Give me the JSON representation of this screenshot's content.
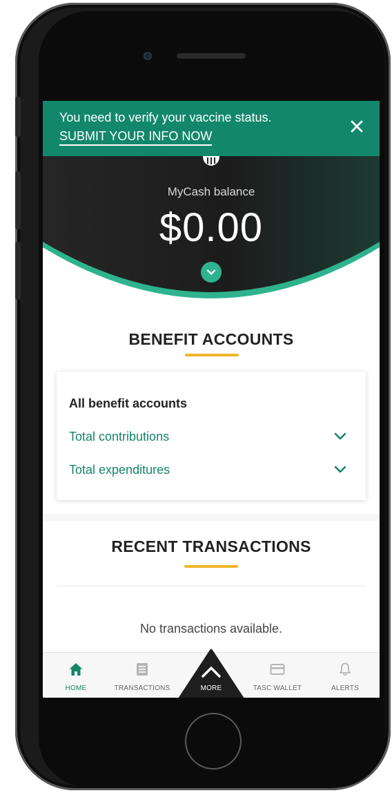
{
  "banner": {
    "message": "You need to verify your vaccine status.",
    "link_label": "SUBMIT YOUR INFO NOW"
  },
  "balance": {
    "label": "MyCash balance",
    "amount": "$0.00"
  },
  "benefit_accounts": {
    "title": "BENEFIT ACCOUNTS",
    "card_heading": "All benefit accounts",
    "rows": [
      {
        "label": "Total contributions"
      },
      {
        "label": "Total expenditures"
      }
    ]
  },
  "recent_transactions": {
    "title": "RECENT TRANSACTIONS",
    "empty_message": "No transactions available."
  },
  "nav": {
    "items": [
      {
        "label": "HOME",
        "icon": "home-icon",
        "active": true
      },
      {
        "label": "TRANSACTIONS",
        "icon": "document-icon",
        "active": false
      },
      {
        "label": "MORE",
        "icon": "chevron-up-icon",
        "active": false
      },
      {
        "label": "TASC WALLET",
        "icon": "card-icon",
        "active": false
      },
      {
        "label": "ALERTS",
        "icon": "bell-icon",
        "active": false
      }
    ]
  },
  "colors": {
    "brand_green": "#13876c",
    "accent_teal": "#2fb38e",
    "link_green": "#14856a",
    "accent_yellow": "#f2b62b",
    "hero_dark": "#1e1e1e"
  }
}
